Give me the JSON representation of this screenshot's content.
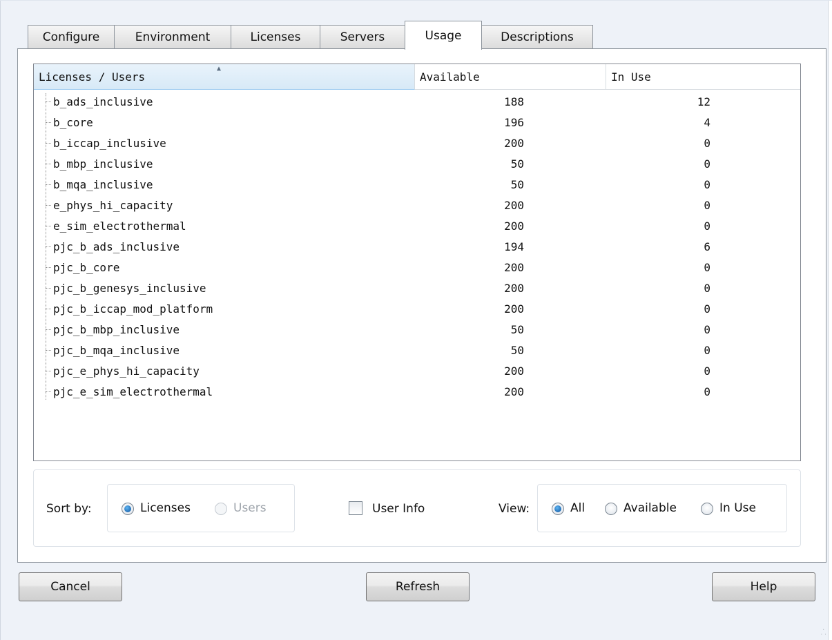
{
  "tabs": [
    {
      "label": "Configure"
    },
    {
      "label": "Environment"
    },
    {
      "label": "Licenses"
    },
    {
      "label": "Servers"
    },
    {
      "label": "Usage",
      "active": true
    },
    {
      "label": "Descriptions"
    }
  ],
  "table": {
    "columns": [
      "Licenses / Users",
      "Available",
      "In Use"
    ],
    "sort_column": "Licenses / Users",
    "rows": [
      {
        "name": "b_ads_inclusive",
        "available": "188",
        "in_use": "12"
      },
      {
        "name": "b_core",
        "available": "196",
        "in_use": "4"
      },
      {
        "name": "b_iccap_inclusive",
        "available": "200",
        "in_use": "0"
      },
      {
        "name": "b_mbp_inclusive",
        "available": "50",
        "in_use": "0"
      },
      {
        "name": "b_mqa_inclusive",
        "available": "50",
        "in_use": "0"
      },
      {
        "name": "e_phys_hi_capacity",
        "available": "200",
        "in_use": "0"
      },
      {
        "name": "e_sim_electrothermal",
        "available": "200",
        "in_use": "0"
      },
      {
        "name": "pjc_b_ads_inclusive",
        "available": "194",
        "in_use": "6"
      },
      {
        "name": "pjc_b_core",
        "available": "200",
        "in_use": "0"
      },
      {
        "name": "pjc_b_genesys_inclusive",
        "available": "200",
        "in_use": "0"
      },
      {
        "name": "pjc_b_iccap_mod_platform",
        "available": "200",
        "in_use": "0"
      },
      {
        "name": "pjc_b_mbp_inclusive",
        "available": "50",
        "in_use": "0"
      },
      {
        "name": "pjc_b_mqa_inclusive",
        "available": "50",
        "in_use": "0"
      },
      {
        "name": "pjc_e_phys_hi_capacity",
        "available": "200",
        "in_use": "0"
      },
      {
        "name": "pjc_e_sim_electrothermal",
        "available": "200",
        "in_use": "0"
      }
    ]
  },
  "options": {
    "sort_by_label": "Sort by:",
    "sort_licenses": "Licenses",
    "sort_users": "Users",
    "sort_selected": "Licenses",
    "user_info_label": "User Info",
    "user_info_checked": false,
    "view_label": "View:",
    "view_all": "All",
    "view_available": "Available",
    "view_in_use": "In Use",
    "view_selected": "All"
  },
  "buttons": {
    "cancel": "Cancel",
    "refresh": "Refresh",
    "help": "Help"
  },
  "icons": {
    "sort": "sort-ascending-icon",
    "resize": "resize-grip-icon"
  }
}
